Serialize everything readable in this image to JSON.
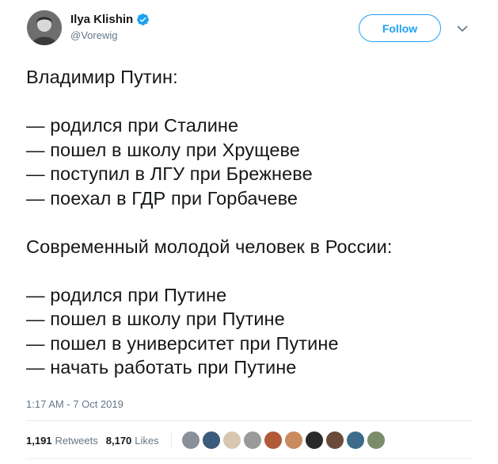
{
  "author": {
    "name": "Ilya Klishin",
    "handle": "@Vorewig",
    "verified": true
  },
  "follow_button": {
    "label": "Follow"
  },
  "tweet": {
    "lines": [
      "Владимир Путин:",
      "",
      "— родился при Сталине",
      "— пошел в школу при Хрущеве",
      "— поступил в ЛГУ при Брежневе",
      "— поехал в ГДР при Горбачеве",
      "",
      "Современный молодой человек в России:",
      "",
      "— родился при Путине",
      "— пошел в школу при Путине",
      "— пошел в университет при Путине",
      "— начать работать при Путине"
    ]
  },
  "timestamp": "1:17 AM - 7 Oct 2019",
  "stats": {
    "retweets_count": "1,191",
    "retweets_label": "Retweets",
    "likes_count": "8,170",
    "likes_label": "Likes"
  },
  "likers": [
    {
      "color": "#8a8f99"
    },
    {
      "color": "#3c5a7a"
    },
    {
      "color": "#d8c7b0"
    },
    {
      "color": "#9a9a9a"
    },
    {
      "color": "#b05a3a"
    },
    {
      "color": "#c98a5e"
    },
    {
      "color": "#2a2a2a"
    },
    {
      "color": "#6b4a3a"
    },
    {
      "color": "#3d6b8a"
    },
    {
      "color": "#7a8c6a"
    }
  ],
  "colors": {
    "accent": "#1da1f2",
    "muted": "#657786",
    "text": "#14171a"
  }
}
